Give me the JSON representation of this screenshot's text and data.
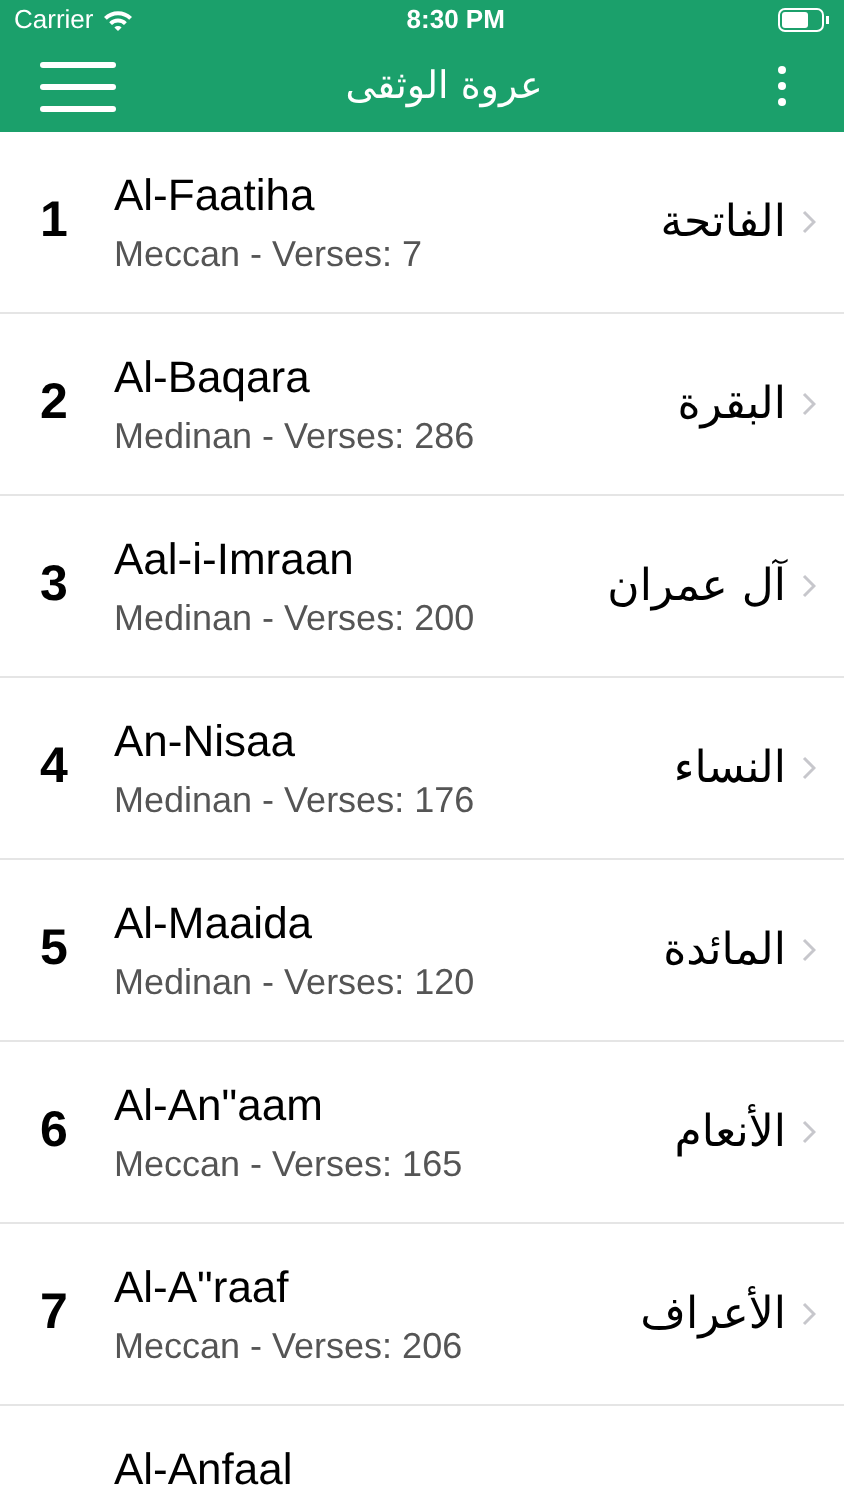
{
  "status_bar": {
    "carrier": "Carrier",
    "time": "8:30 PM"
  },
  "header": {
    "title": "عروة الوثقى"
  },
  "surahs": [
    {
      "number": "1",
      "name": "Al-Faatiha",
      "details": "Meccan - Verses: 7",
      "arabic": "الفاتحة"
    },
    {
      "number": "2",
      "name": "Al-Baqara",
      "details": "Medinan - Verses: 286",
      "arabic": "البقرة"
    },
    {
      "number": "3",
      "name": "Aal-i-Imraan",
      "details": "Medinan - Verses: 200",
      "arabic": "آل عمران"
    },
    {
      "number": "4",
      "name": "An-Nisaa",
      "details": "Medinan - Verses: 176",
      "arabic": "النساء"
    },
    {
      "number": "5",
      "name": "Al-Maaida",
      "details": "Medinan - Verses: 120",
      "arabic": "المائدة"
    },
    {
      "number": "6",
      "name": "Al-An\"aam",
      "details": "Meccan - Verses: 165",
      "arabic": "الأنعام"
    },
    {
      "number": "7",
      "name": "Al-A\"raaf",
      "details": "Meccan - Verses: 206",
      "arabic": "الأعراف"
    },
    {
      "name": "Al-Anfaal"
    }
  ]
}
